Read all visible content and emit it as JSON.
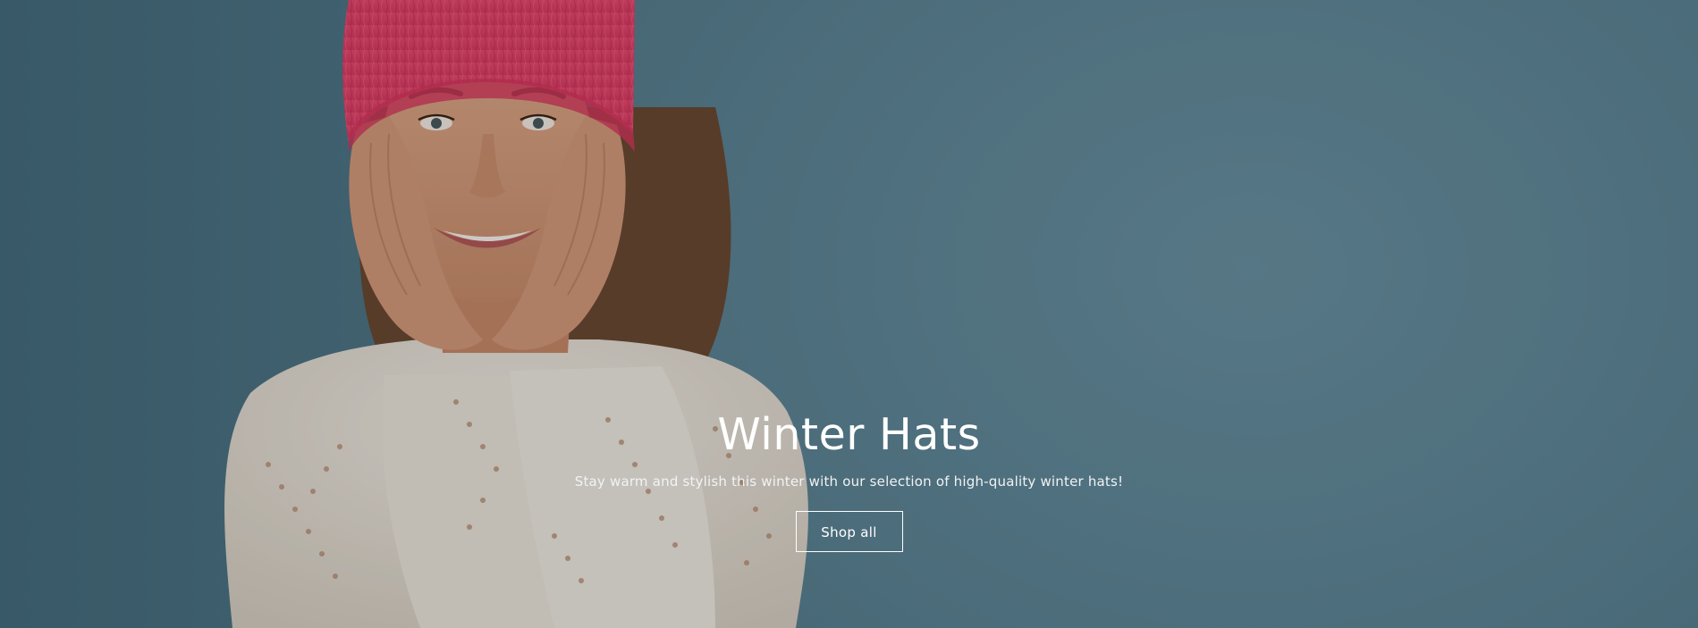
{
  "hero": {
    "title": "Winter Hats",
    "subtitle": "Stay warm and stylish this winter with our selection of high-quality winter hats!",
    "cta_label": "Shop all",
    "colors": {
      "background": "#5e8596",
      "hat": "#e3436a",
      "sweater": "#e8e2d8",
      "skin": "#d9a383",
      "hair": "#6b4a32",
      "text": "#ffffff"
    }
  }
}
